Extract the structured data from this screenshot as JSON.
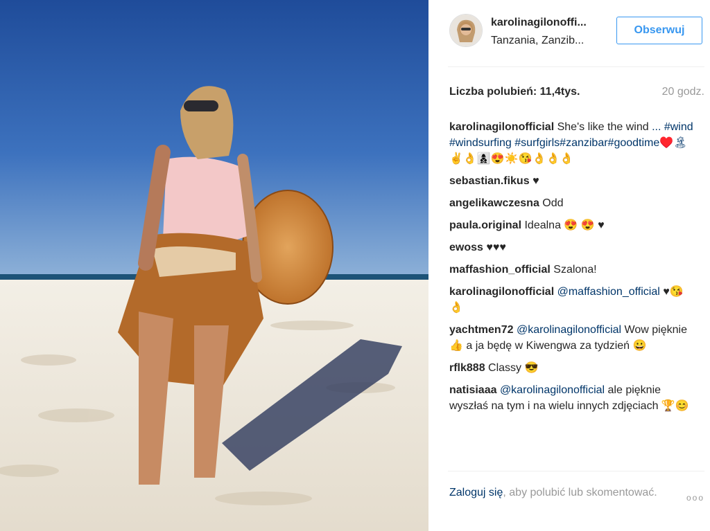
{
  "post": {
    "username": "karolinagilonoffi...",
    "location": "Tanzania, Zanzib...",
    "follow_label": "Obserwuj",
    "likes_text": "Liczba polubień: 11,4tys.",
    "time_ago": "20 godz."
  },
  "comments": [
    {
      "user": "karolinagilonofficial",
      "text": "She's like the wind",
      "mention": "",
      "rest": "... #wind #windsurfing #surfgirls#zanzibar#goodtime♥️🏝✌️👌👩‍👦‍👦😍☀️😘👌👌👌"
    },
    {
      "user": "sebastian.fikus",
      "text": "♥",
      "mention": "",
      "rest": ""
    },
    {
      "user": "angelikawczesna",
      "text": "Odd",
      "mention": "",
      "rest": ""
    },
    {
      "user": "paula.original",
      "text": "Idealna 😍 😍 ♥",
      "mention": "",
      "rest": ""
    },
    {
      "user": "ewoss",
      "text": "♥♥♥",
      "mention": "",
      "rest": ""
    },
    {
      "user": "maffashion_official",
      "text": "Szalona!",
      "mention": "",
      "rest": ""
    },
    {
      "user": "karolinagilonofficial",
      "text": "",
      "mention": "@maffashion_official",
      "rest": "♥😘👌"
    },
    {
      "user": "yachtmen72",
      "text": "",
      "mention": "@karolinagilonofficial",
      "rest": "Wow pięknie 👍 a ja będę w Kiwengwa za tydzień 😀"
    },
    {
      "user": "rflk888",
      "text": "Classy 😎",
      "mention": "",
      "rest": ""
    },
    {
      "user": "natisiaaa",
      "text": "",
      "mention": "@karolinagilonofficial",
      "rest": "ale pięknie wyszłaś na tym i na wielu innych zdjęciach 🏆😊"
    }
  ],
  "footer": {
    "login_label": "Zaloguj się",
    "rest_text": ", aby polubić lub skomentować.",
    "more_label": "ooo"
  },
  "colors": {
    "accent": "#3897f0",
    "link": "#003569",
    "muted": "#999999"
  }
}
